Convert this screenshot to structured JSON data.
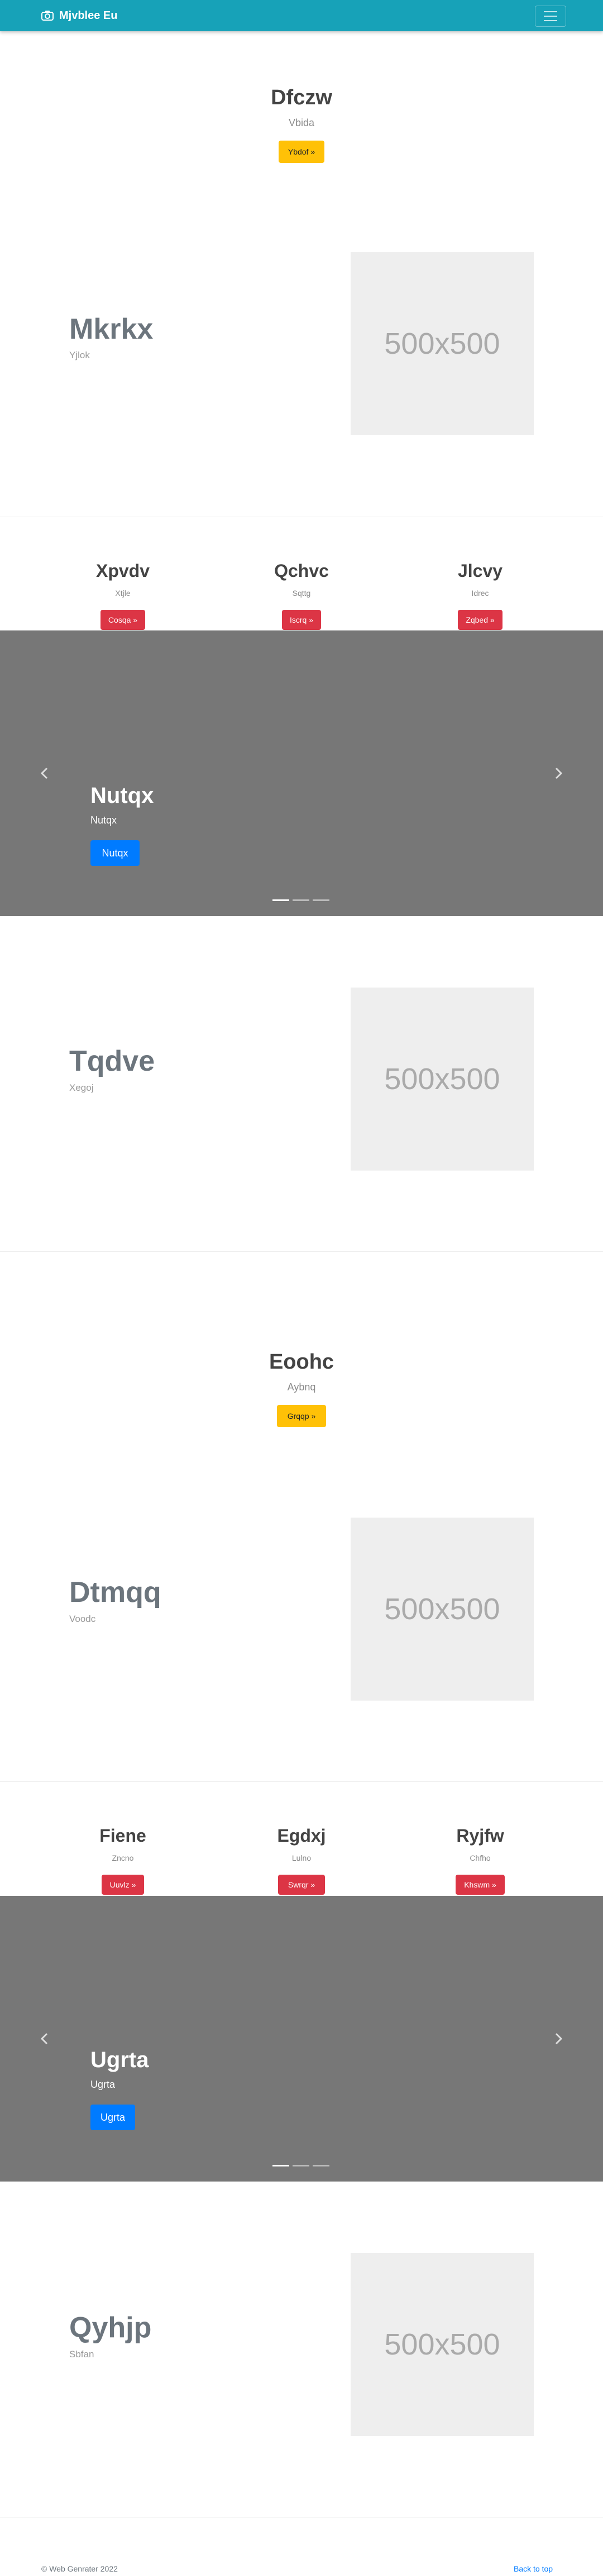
{
  "navbar": {
    "brand": "Mjvblee Eu",
    "icon": "camera-icon",
    "menu_icon": "hamburger-icon",
    "color": "#17a2b8"
  },
  "hero1": {
    "title": "Dfczw",
    "subtitle": "Vbida",
    "button": "Ybdof »"
  },
  "feature1": {
    "title": "Mkrkx",
    "subtitle": "Yjlok",
    "image": "500x500"
  },
  "columns1": [
    {
      "title": "Xpvdv",
      "subtitle": "Xtjle",
      "button": "Cosqa »"
    },
    {
      "title": "Qchvc",
      "subtitle": "Sqttg",
      "button": "Iscrq »"
    },
    {
      "title": "Jlcvy",
      "subtitle": "Idrec",
      "button": "Zqbed »"
    }
  ],
  "carousel1": {
    "title": "Nutqx",
    "subtitle": "Nutqx",
    "button": "Nutqx",
    "prev_icon": "chevron-left-icon",
    "next_icon": "chevron-right-icon",
    "active_index": 0,
    "slide_count": 3
  },
  "feature2": {
    "title": "Tqdve",
    "subtitle": "Xegoj",
    "image": "500x500"
  },
  "hero2": {
    "title": "Eoohc",
    "subtitle": "Aybnq",
    "button": "Grqqp »"
  },
  "feature3": {
    "title": "Dtmqq",
    "subtitle": "Voodc",
    "image": "500x500"
  },
  "columns2": [
    {
      "title": "Fiene",
      "subtitle": "Zncno",
      "button": "Uuvlz »"
    },
    {
      "title": "Egdxj",
      "subtitle": "Lulno",
      "button": "Swrqr »"
    },
    {
      "title": "Ryjfw",
      "subtitle": "Chfho",
      "button": "Khswm »"
    }
  ],
  "carousel2": {
    "title": "Ugrta",
    "subtitle": "Ugrta",
    "button": "Ugrta",
    "prev_icon": "chevron-left-icon",
    "next_icon": "chevron-right-icon",
    "active_index": 0,
    "slide_count": 3
  },
  "feature4": {
    "title": "Qyhjp",
    "subtitle": "Sbfan",
    "image": "500x500"
  },
  "footer": {
    "copyright": "© Web Genrater 2022",
    "back_to_top": "Back to top"
  },
  "colors": {
    "teal": "#17a2b8",
    "yellow": "#ffc107",
    "red": "#dc3545",
    "blue": "#007bff",
    "carousel_bg": "#777777",
    "placeholder_bg": "#eeeeee"
  }
}
